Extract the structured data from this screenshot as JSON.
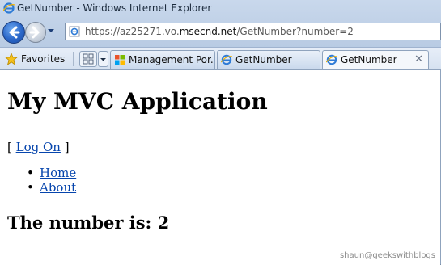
{
  "window": {
    "title": "GetNumber - Windows Internet Explorer"
  },
  "address_bar": {
    "prefix": "https://az25271.vo.",
    "domain": "msecnd.net",
    "path": "/GetNumber?number=2"
  },
  "favorites": {
    "label": "Favorites"
  },
  "tabs": [
    {
      "label": "Management Por...",
      "active": false
    },
    {
      "label": "GetNumber",
      "active": false
    },
    {
      "label": "GetNumber",
      "active": true
    }
  ],
  "page": {
    "heading": "My MVC Application",
    "logon_open": "[ ",
    "logon_link": "Log On",
    "logon_close": " ]",
    "menu": [
      "Home",
      "About"
    ],
    "number_text": "The number is: 2"
  },
  "watermark": "shaun@geekswithblogs",
  "icons": {
    "ie": "ie-logo-icon",
    "back": "back-arrow-icon",
    "forward": "forward-arrow-icon",
    "star": "favorites-star-icon",
    "quick_tabs": "quick-tabs-grid-icon",
    "close": "close-icon"
  },
  "colors": {
    "link": "#0645ad",
    "chrome": "#b8cbe3"
  }
}
